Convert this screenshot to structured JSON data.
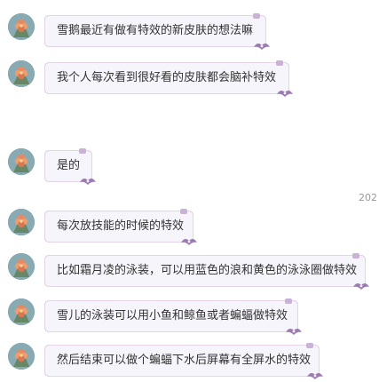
{
  "chat": {
    "timestamp": "202",
    "colors": {
      "bubble_border": "#b895c6",
      "bubble_bg": "#f6f5fb",
      "text": "#333333",
      "timestamp": "#9a9a9a"
    },
    "messages": [
      {
        "text": "雪鹅最近有做有特效的新皮肤的想法嘛",
        "avatar_icon": "avatar-flower-icon"
      },
      {
        "text": "我个人每次看到很好看的皮肤都会脑补特效",
        "avatar_icon": "avatar-flower-icon"
      },
      {
        "text": "是的",
        "avatar_icon": "avatar-flower-icon"
      },
      {
        "text": "每次放技能的时候的特效",
        "avatar_icon": "avatar-flower-icon"
      },
      {
        "text": "比如霜月凌的泳装，可以用蓝色的浪和黄色的泳泳圈做特效",
        "avatar_icon": "avatar-flower-icon"
      },
      {
        "text": "雪儿的泳装可以用小鱼和鲸鱼或者蝙蝠做特效",
        "avatar_icon": "avatar-flower-icon"
      },
      {
        "text": "然后结束可以做个蝙蝠下水后屏幕有全屏水的特效",
        "avatar_icon": "avatar-flower-icon"
      }
    ]
  }
}
